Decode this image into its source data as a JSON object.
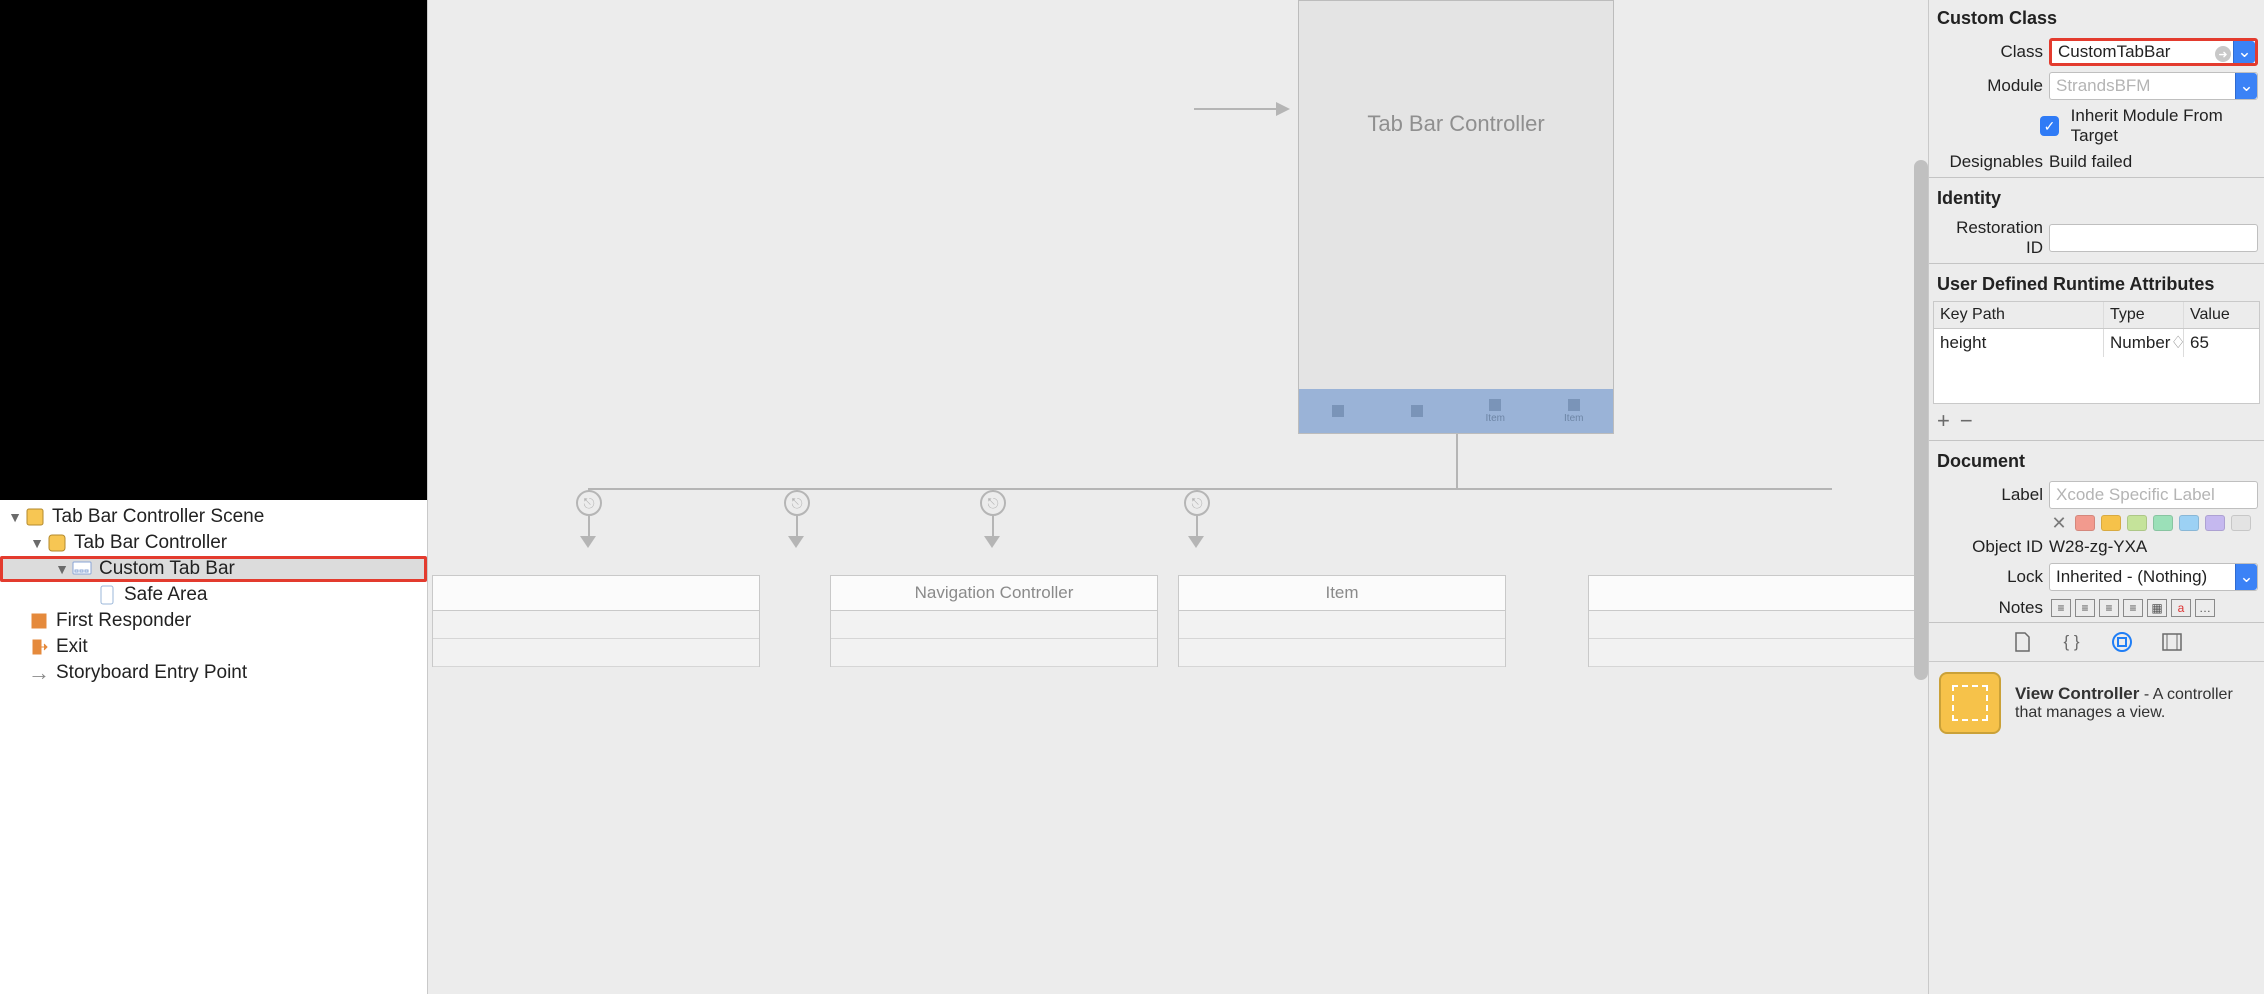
{
  "outline": {
    "scene": "Tab Bar Controller Scene",
    "vc": "Tab Bar Controller",
    "customTabBar": "Custom Tab Bar",
    "safeArea": "Safe Area",
    "firstResponder": "First Responder",
    "exit": "Exit",
    "entryPoint": "Storyboard Entry Point"
  },
  "canvas": {
    "sceneTitle": "Tab Bar Controller",
    "tab3": "Item",
    "tab4": "Item",
    "child1": "Navigation Controller",
    "child2": "Item"
  },
  "inspector": {
    "customClass": {
      "section": "Custom Class",
      "classLabel": "Class",
      "classValue": "CustomTabBar",
      "moduleLabel": "Module",
      "modulePlaceholder": "StrandsBFM",
      "inherit": "Inherit Module From Target",
      "designablesLabel": "Designables",
      "designablesValue": "Build failed"
    },
    "identity": {
      "section": "Identity",
      "restorationLabel": "Restoration ID"
    },
    "attrs": {
      "section": "User Defined Runtime Attributes",
      "keyHead": "Key Path",
      "typeHead": "Type",
      "valHead": "Value",
      "keyVal": "height",
      "typeVal": "Number",
      "valVal": "65"
    },
    "document": {
      "section": "Document",
      "labelLabel": "Label",
      "labelPlaceholder": "Xcode Specific Label",
      "objectIdLabel": "Object ID",
      "objectIdValue": "W28-zg-YXA",
      "lockLabel": "Lock",
      "lockValue": "Inherited - (Nothing)",
      "notesLabel": "Notes"
    },
    "swatchColors": [
      "#f29a8e",
      "#f6c24a",
      "#c5e39a",
      "#9be0b8",
      "#9cd1f4",
      "#c5b8ef",
      "#e3e3e3"
    ],
    "library": {
      "title": "View Controller",
      "desc": " - A controller that manages a view."
    }
  }
}
